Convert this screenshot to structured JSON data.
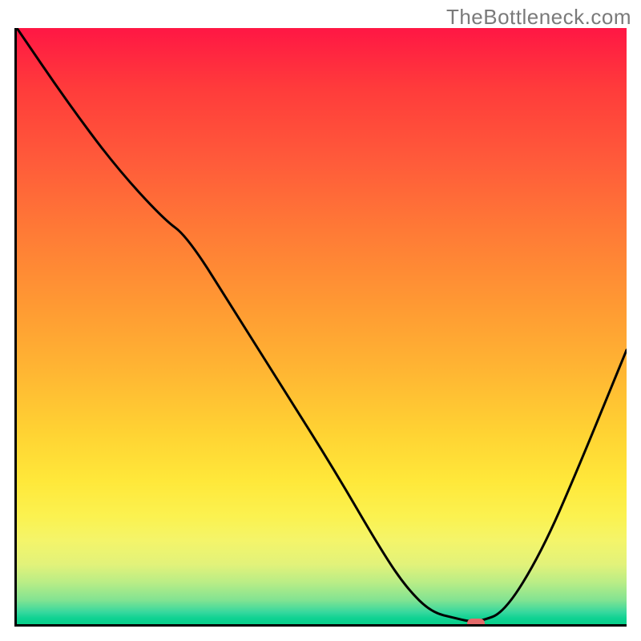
{
  "watermark": "TheBottleneck.com",
  "chart_data": {
    "type": "line",
    "title": "",
    "xlabel": "",
    "ylabel": "",
    "xlim": [
      0,
      100
    ],
    "ylim": [
      0,
      100
    ],
    "grid": false,
    "legend": false,
    "background": {
      "type": "vertical-gradient",
      "stops": [
        {
          "pos": 0,
          "color": "#ff1744"
        },
        {
          "pos": 50,
          "color": "#ffb733"
        },
        {
          "pos": 80,
          "color": "#fbf250"
        },
        {
          "pos": 100,
          "color": "#08cf8a"
        }
      ],
      "meaning": "red (top) = high bottleneck, green (bottom) = no bottleneck"
    },
    "series": [
      {
        "name": "bottleneck-curve",
        "color": "#000000",
        "x": [
          0,
          8,
          16,
          24,
          28,
          36,
          44,
          52,
          60,
          64,
          68,
          72,
          74,
          76,
          80,
          86,
          92,
          100
        ],
        "y": [
          100,
          88,
          77,
          68,
          65,
          52,
          39,
          26,
          12,
          6,
          2,
          1,
          0.5,
          0.5,
          2,
          12,
          26,
          46
        ]
      }
    ],
    "marker": {
      "name": "optimal-point",
      "x": 75,
      "y": 0.5,
      "color": "#e46a6a",
      "shape": "rounded-rect"
    }
  }
}
